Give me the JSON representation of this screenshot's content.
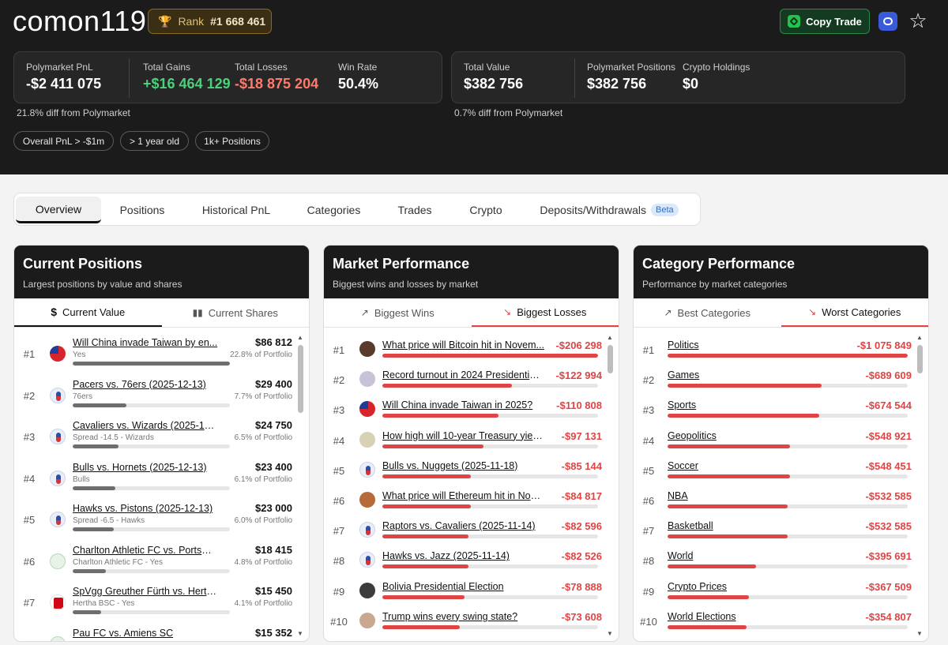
{
  "header": {
    "username": "comon119",
    "rank_label": "Rank",
    "rank_value": "#1 668 461",
    "copy_trade_label": "Copy Trade"
  },
  "stats_left": {
    "pnl_label": "Polymarket PnL",
    "pnl_value": "-$2 411 075",
    "gains_label": "Total Gains",
    "gains_value": "+$16 464 129",
    "losses_label": "Total Losses",
    "losses_value": "-$18 875 204",
    "winrate_label": "Win Rate",
    "winrate_value": "50.4%",
    "diff": "21.8% diff from Polymarket"
  },
  "stats_right": {
    "total_label": "Total Value",
    "total_value": "$382 756",
    "positions_label": "Polymarket Positions",
    "positions_value": "$382 756",
    "crypto_label": "Crypto Holdings",
    "crypto_value": "$0",
    "diff": "0.7% diff from Polymarket"
  },
  "chips": [
    "Overall PnL > -$1m",
    "> 1 year old",
    "1k+ Positions"
  ],
  "tabs": [
    "Overview",
    "Positions",
    "Historical PnL",
    "Categories",
    "Trades",
    "Crypto",
    "Deposits/Withdrawals"
  ],
  "beta_label": "Beta",
  "colors": {
    "gain": "#4cd07d",
    "loss": "#ff7a6b",
    "bar_red": "#e04545",
    "bar_gray": "#6e6e6e",
    "copy_green": "#26c24e"
  },
  "current_positions": {
    "title": "Current Positions",
    "subtitle": "Largest positions by value and shares",
    "tab_value": "Current Value",
    "tab_shares": "Current Shares",
    "items": [
      {
        "rank": "#1",
        "icon": "taiwan-flag-icon",
        "name": "Will China invade Taiwan by en...",
        "sub": "Yes",
        "amount": "$86 812",
        "pct": "22.8% of Portfolio",
        "bar": 1.0
      },
      {
        "rank": "#2",
        "icon": "nba-logo-icon",
        "name": "Pacers vs. 76ers (2025-12-13)",
        "sub": "76ers",
        "amount": "$29 400",
        "pct": "7.7% of Portfolio",
        "bar": 0.34
      },
      {
        "rank": "#3",
        "icon": "nba-logo-icon",
        "name": "Cavaliers vs. Wizards (2025-12-...",
        "sub": "Spread -14.5 - Wizards",
        "amount": "$24 750",
        "pct": "6.5% of Portfolio",
        "bar": 0.29
      },
      {
        "rank": "#4",
        "icon": "nba-logo-icon",
        "name": "Bulls vs. Hornets (2025-12-13)",
        "sub": "Bulls",
        "amount": "$23 400",
        "pct": "6.1% of Portfolio",
        "bar": 0.27
      },
      {
        "rank": "#5",
        "icon": "nba-logo-icon",
        "name": "Hawks vs. Pistons (2025-12-13)",
        "sub": "Spread -6.5 - Hawks",
        "amount": "$23 000",
        "pct": "6.0% of Portfolio",
        "bar": 0.26
      },
      {
        "rank": "#6",
        "icon": "soccer-icon",
        "name": "Charlton Athletic FC vs. Portsmo...",
        "sub": "Charlton Athletic FC - Yes",
        "amount": "$18 415",
        "pct": "4.8% of Portfolio",
        "bar": 0.21
      },
      {
        "rank": "#7",
        "icon": "bundesliga-icon",
        "name": "SpVgg Greuther Fürth vs. Hertha ...",
        "sub": "Hertha BSC - Yes",
        "amount": "$15 450",
        "pct": "4.1% of Portfolio",
        "bar": 0.18
      },
      {
        "rank": "",
        "icon": "soccer-icon",
        "name": "Pau FC vs. Amiens SC",
        "sub": "",
        "amount": "$15 352",
        "pct": "",
        "bar": 0.18
      }
    ]
  },
  "market_performance": {
    "title": "Market Performance",
    "subtitle": "Biggest wins and losses by market",
    "tab_wins": "Biggest Wins",
    "tab_losses": "Biggest Losses",
    "items": [
      {
        "rank": "#1",
        "icon": "bitcoin-icon",
        "name": "What price will Bitcoin hit in Novem...",
        "amount": "-$206 298",
        "bar": 1.0
      },
      {
        "rank": "#2",
        "icon": "election-icon",
        "name": "Record turnout in 2024 Presidential ...",
        "amount": "-$122 994",
        "bar": 0.6
      },
      {
        "rank": "#3",
        "icon": "taiwan-flag-icon",
        "name": "Will China invade Taiwan in 2025?",
        "amount": "-$110 808",
        "bar": 0.54
      },
      {
        "rank": "#4",
        "icon": "treasury-icon",
        "name": "How high will 10-year Treasury yield ...",
        "amount": "-$97 131",
        "bar": 0.47
      },
      {
        "rank": "#5",
        "icon": "nba-logo-icon",
        "name": "Bulls vs. Nuggets (2025-11-18)",
        "amount": "-$85 144",
        "bar": 0.41
      },
      {
        "rank": "#6",
        "icon": "ethereum-icon",
        "name": "What price will Ethereum hit in Nove...",
        "amount": "-$84 817",
        "bar": 0.41
      },
      {
        "rank": "#7",
        "icon": "nba-logo-icon",
        "name": "Raptors vs. Cavaliers (2025-11-14)",
        "amount": "-$82 596",
        "bar": 0.4
      },
      {
        "rank": "#8",
        "icon": "nba-logo-icon",
        "name": "Hawks vs. Jazz (2025-11-14)",
        "amount": "-$82 526",
        "bar": 0.4
      },
      {
        "rank": "#9",
        "icon": "person-icon",
        "name": "Bolivia Presidential Election",
        "amount": "-$78 888",
        "bar": 0.38
      },
      {
        "rank": "#10",
        "icon": "trump-icon",
        "name": "Trump wins every swing state?",
        "amount": "-$73 608",
        "bar": 0.36
      }
    ]
  },
  "category_performance": {
    "title": "Category Performance",
    "subtitle": "Performance by market categories",
    "tab_best": "Best Categories",
    "tab_worst": "Worst Categories",
    "items": [
      {
        "rank": "#1",
        "name": "Politics",
        "amount": "-$1 075 849",
        "bar": 1.0
      },
      {
        "rank": "#2",
        "name": "Games",
        "amount": "-$689 609",
        "bar": 0.64
      },
      {
        "rank": "#3",
        "name": "Sports",
        "amount": "-$674 544",
        "bar": 0.63
      },
      {
        "rank": "#4",
        "name": "Geopolitics",
        "amount": "-$548 921",
        "bar": 0.51
      },
      {
        "rank": "#5",
        "name": "Soccer",
        "amount": "-$548 451",
        "bar": 0.51
      },
      {
        "rank": "#6",
        "name": "NBA",
        "amount": "-$532 585",
        "bar": 0.5
      },
      {
        "rank": "#7",
        "name": "Basketball",
        "amount": "-$532 585",
        "bar": 0.5
      },
      {
        "rank": "#8",
        "name": "World",
        "amount": "-$395 691",
        "bar": 0.37
      },
      {
        "rank": "#9",
        "name": "Crypto Prices",
        "amount": "-$367 509",
        "bar": 0.34
      },
      {
        "rank": "#10",
        "name": "World Elections",
        "amount": "-$354 807",
        "bar": 0.33
      }
    ]
  }
}
